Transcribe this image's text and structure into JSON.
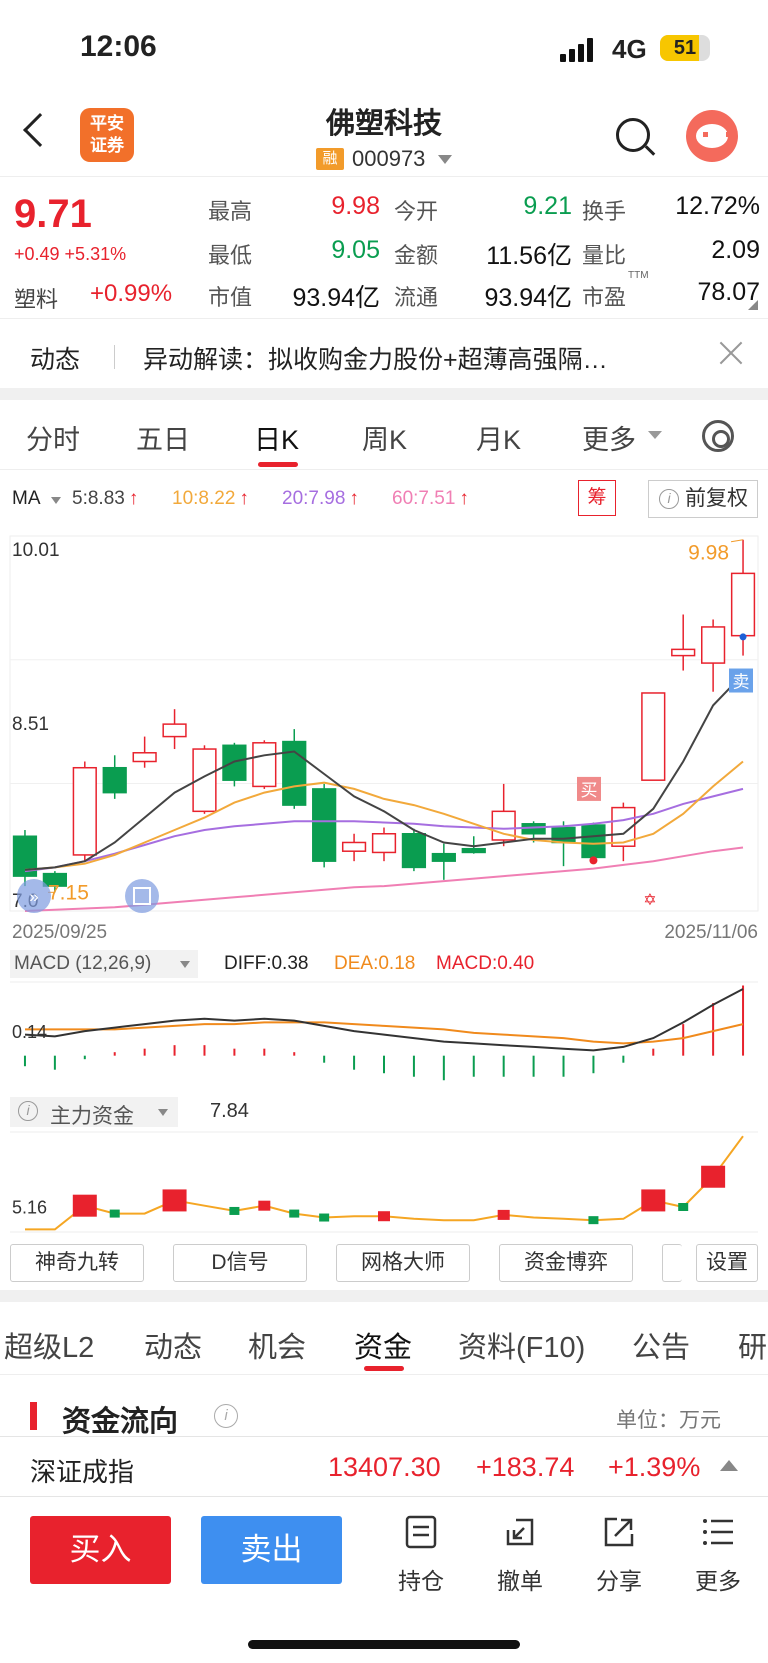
{
  "status": {
    "time": "12:06",
    "network": "4G",
    "battery": "51"
  },
  "header": {
    "logo": "平安\n证券",
    "name": "佛塑科技",
    "rong": "融",
    "code": "000973"
  },
  "quote": {
    "price": "9.71",
    "change": "+0.49 +5.31%",
    "sector": "塑料",
    "sector_change": "+0.99%",
    "rows": [
      [
        {
          "label": "最高",
          "value": "9.98",
          "color": "red"
        },
        {
          "label": "今开",
          "value": "9.21",
          "color": "green"
        },
        {
          "label": "换手",
          "value": "12.72%",
          "color": "dark"
        }
      ],
      [
        {
          "label": "最低",
          "value": "9.05",
          "color": "green"
        },
        {
          "label": "金额",
          "value": "11.56亿",
          "color": "dark"
        },
        {
          "label": "量比",
          "value": "2.09",
          "color": "dark"
        }
      ],
      [
        {
          "label": "市值",
          "value": "93.94亿",
          "color": "dark"
        },
        {
          "label": "流通",
          "value": "93.94亿",
          "color": "dark"
        },
        {
          "label": "市盈",
          "value": "78.07",
          "color": "dark"
        }
      ]
    ],
    "ttm": "TTM"
  },
  "news": {
    "label": "动态",
    "text": "异动解读：拟收购金力股份+超薄高强隔…"
  },
  "period_tabs": [
    "分时",
    "五日",
    "日K",
    "周K",
    "月K",
    "更多"
  ],
  "ma_legend": {
    "label": "MA",
    "items": [
      {
        "text": "5:8.83",
        "color": "#444444"
      },
      {
        "text": "10:8.22",
        "color": "#f2a93b"
      },
      {
        "text": "20:7.98",
        "color": "#a66ee0"
      },
      {
        "text": "60:7.51",
        "color": "#f07fb4"
      }
    ],
    "chip": "筹",
    "fuquan": "前复权"
  },
  "chart_data": {
    "type": "candlestick",
    "y_top_label": "10.01",
    "y_mid_label": "8.51",
    "y_bottom_label": "7.0",
    "ylim": [
      7.0,
      10.01
    ],
    "x_start_label": "2025/09/25",
    "x_end_label": "2025/11/06",
    "high_marker": "9.98",
    "low_marker": "7.15",
    "buy_marker": "买",
    "sell_marker": "卖",
    "candles": [
      {
        "o": 7.6,
        "c": 7.28,
        "h": 7.65,
        "l": 7.2
      },
      {
        "o": 7.3,
        "c": 7.2,
        "h": 7.32,
        "l": 7.15
      },
      {
        "o": 7.45,
        "c": 8.15,
        "h": 8.2,
        "l": 7.4
      },
      {
        "o": 8.15,
        "c": 7.95,
        "h": 8.25,
        "l": 7.9
      },
      {
        "o": 8.2,
        "c": 8.27,
        "h": 8.4,
        "l": 8.15
      },
      {
        "o": 8.4,
        "c": 8.5,
        "h": 8.62,
        "l": 8.3
      },
      {
        "o": 7.8,
        "c": 8.3,
        "h": 8.33,
        "l": 7.78
      },
      {
        "o": 8.33,
        "c": 8.05,
        "h": 8.35,
        "l": 8.0
      },
      {
        "o": 8.0,
        "c": 8.35,
        "h": 8.37,
        "l": 7.98
      },
      {
        "o": 8.36,
        "c": 7.85,
        "h": 8.46,
        "l": 7.82
      },
      {
        "o": 7.98,
        "c": 7.4,
        "h": 8.02,
        "l": 7.35
      },
      {
        "o": 7.48,
        "c": 7.55,
        "h": 7.62,
        "l": 7.4
      },
      {
        "o": 7.47,
        "c": 7.62,
        "h": 7.67,
        "l": 7.4
      },
      {
        "o": 7.62,
        "c": 7.35,
        "h": 7.66,
        "l": 7.32
      },
      {
        "o": 7.46,
        "c": 7.4,
        "h": 7.54,
        "l": 7.25
      },
      {
        "o": 7.5,
        "c": 7.47,
        "h": 7.6,
        "l": 7.46
      },
      {
        "o": 7.57,
        "c": 7.8,
        "h": 8.02,
        "l": 7.52
      },
      {
        "o": 7.7,
        "c": 7.62,
        "h": 7.72,
        "l": 7.55
      },
      {
        "o": 7.67,
        "c": 7.55,
        "h": 7.72,
        "l": 7.36
      },
      {
        "o": 7.69,
        "c": 7.43,
        "h": 7.71,
        "l": 7.41
      },
      {
        "o": 7.52,
        "c": 7.83,
        "h": 7.87,
        "l": 7.4
      },
      {
        "o": 8.05,
        "c": 8.75,
        "h": 8.75,
        "l": 8.05
      },
      {
        "o": 9.05,
        "c": 9.1,
        "h": 9.38,
        "l": 8.93
      },
      {
        "o": 8.99,
        "c": 9.28,
        "h": 9.34,
        "l": 8.76
      },
      {
        "o": 9.21,
        "c": 9.71,
        "h": 9.98,
        "l": 9.05
      }
    ],
    "ma5": [
      7.33,
      7.35,
      7.4,
      7.55,
      7.75,
      7.95,
      8.08,
      8.2,
      8.25,
      8.28,
      8.1,
      7.92,
      7.8,
      7.65,
      7.55,
      7.52,
      7.55,
      7.58,
      7.58,
      7.6,
      7.62,
      7.82,
      8.2,
      8.65,
      8.9
    ],
    "ma10": [
      7.33,
      7.35,
      7.38,
      7.45,
      7.55,
      7.65,
      7.75,
      7.87,
      7.95,
      8.0,
      8.03,
      7.98,
      7.9,
      7.85,
      7.78,
      7.7,
      7.62,
      7.57,
      7.55,
      7.54,
      7.55,
      7.62,
      7.78,
      8.0,
      8.2
    ],
    "ma20": [
      7.32,
      7.35,
      7.4,
      7.46,
      7.53,
      7.6,
      7.65,
      7.68,
      7.7,
      7.72,
      7.72,
      7.72,
      7.71,
      7.7,
      7.68,
      7.67,
      7.66,
      7.67,
      7.68,
      7.7,
      7.73,
      7.78,
      7.86,
      7.92,
      7.98
    ],
    "ma60": [
      7.0,
      7.01,
      7.02,
      7.03,
      7.05,
      7.07,
      7.09,
      7.11,
      7.13,
      7.15,
      7.17,
      7.19,
      7.2,
      7.22,
      7.24,
      7.26,
      7.28,
      7.3,
      7.32,
      7.34,
      7.37,
      7.4,
      7.44,
      7.48,
      7.51
    ]
  },
  "macd": {
    "label": "MACD (12,26,9)",
    "diff": "DIFF:0.38",
    "dea": "DEA:0.18",
    "macd": "MACD:0.40",
    "axis_label": "0.14",
    "ylim": [
      -0.15,
      0.42
    ],
    "diff_series": [
      0.12,
      0.11,
      0.14,
      0.16,
      0.18,
      0.2,
      0.21,
      0.2,
      0.21,
      0.2,
      0.17,
      0.14,
      0.12,
      0.1,
      0.08,
      0.07,
      0.06,
      0.05,
      0.04,
      0.03,
      0.05,
      0.1,
      0.19,
      0.29,
      0.38
    ],
    "dea_series": [
      0.15,
      0.15,
      0.15,
      0.15,
      0.16,
      0.17,
      0.18,
      0.18,
      0.19,
      0.19,
      0.19,
      0.18,
      0.17,
      0.16,
      0.15,
      0.13,
      0.12,
      0.11,
      0.1,
      0.08,
      0.07,
      0.08,
      0.1,
      0.14,
      0.18
    ],
    "hist": [
      -0.06,
      -0.08,
      -0.02,
      0.02,
      0.04,
      0.06,
      0.06,
      0.04,
      0.04,
      0.02,
      -0.04,
      -0.08,
      -0.1,
      -0.12,
      -0.14,
      -0.12,
      -0.12,
      -0.12,
      -0.12,
      -0.1,
      -0.04,
      0.04,
      0.18,
      0.3,
      0.4
    ]
  },
  "capital": {
    "label": "主力资金",
    "value": "7.84",
    "axis_label": "5.16",
    "ylim": [
      4.2,
      8.0
    ],
    "series": [
      4.3,
      4.3,
      5.2,
      4.9,
      4.9,
      5.4,
      5.2,
      5.0,
      5.2,
      4.9,
      4.75,
      4.8,
      4.8,
      4.7,
      4.65,
      4.65,
      4.85,
      4.75,
      4.7,
      4.65,
      4.7,
      5.4,
      5.15,
      6.3,
      7.84
    ],
    "markers": [
      {
        "i": 2,
        "type": "bigred"
      },
      {
        "i": 3,
        "type": "green"
      },
      {
        "i": 5,
        "type": "bigred"
      },
      {
        "i": 7,
        "type": "green"
      },
      {
        "i": 8,
        "type": "red"
      },
      {
        "i": 9,
        "type": "green"
      },
      {
        "i": 10,
        "type": "green"
      },
      {
        "i": 12,
        "type": "red"
      },
      {
        "i": 16,
        "type": "red"
      },
      {
        "i": 19,
        "type": "green"
      },
      {
        "i": 21,
        "type": "bigred"
      },
      {
        "i": 22,
        "type": "green"
      },
      {
        "i": 23,
        "type": "bigred"
      }
    ]
  },
  "tools": [
    "神奇九转",
    "D信号",
    "网格大师",
    "资金博弈",
    "设置"
  ],
  "section_tabs": [
    "超级L2",
    "动态",
    "机会",
    "资金",
    "资料(F10)",
    "公告",
    "研"
  ],
  "flow": {
    "title": "资金流向",
    "unit": "单位：万元"
  },
  "index": {
    "name": "深证成指",
    "value": "13407.30",
    "change": "+183.74",
    "pct": "+1.39%"
  },
  "bottom": {
    "buy": "买入",
    "sell": "卖出",
    "nav": [
      "持仓",
      "撤单",
      "分享",
      "更多"
    ]
  }
}
